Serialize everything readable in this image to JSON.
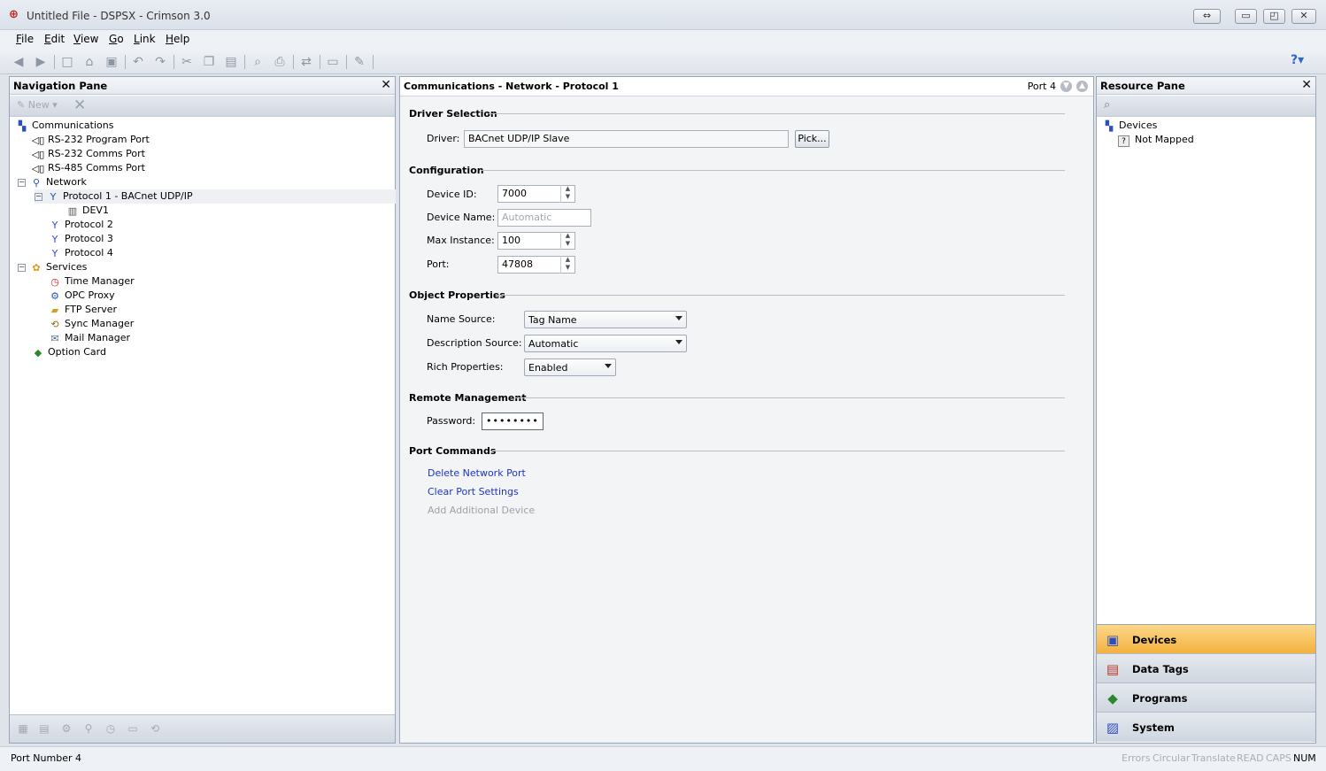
{
  "window": {
    "title": "Untitled File - DSPSX - Crimson 3.0",
    "app_icon": "crimson-app-icon",
    "controls": [
      "restore-toggle-icon",
      "minimize-icon",
      "maximize-icon",
      "close-icon"
    ]
  },
  "menu": [
    {
      "label": "File"
    },
    {
      "label": "Edit"
    },
    {
      "label": "View"
    },
    {
      "label": "Go"
    },
    {
      "label": "Link"
    },
    {
      "label": "Help"
    }
  ],
  "toolbar_icons": [
    "back-icon",
    "forward-icon",
    "new-file-icon",
    "open-icon",
    "save-icon",
    "undo-icon",
    "redo-icon",
    "cut-icon",
    "copy-icon",
    "paste-icon",
    "find-icon",
    "print-icon",
    "link-icon",
    "window-icon",
    "tool-icon",
    "help-icon"
  ],
  "nav_pane": {
    "title": "Navigation Pane",
    "new_label": "New",
    "tree": [
      {
        "label": "Communications",
        "icon": "communications-icon"
      },
      {
        "label": "RS-232 Program Port",
        "icon": "serial-port-icon"
      },
      {
        "label": "RS-232 Comms Port",
        "icon": "serial-port-icon"
      },
      {
        "label": "RS-485 Comms Port",
        "icon": "serial-port-icon"
      },
      {
        "label": "Network",
        "icon": "network-icon",
        "toggle": "−"
      },
      {
        "label": "Protocol 1 - BACnet UDP/IP",
        "icon": "protocol-icon",
        "toggle": "−"
      },
      {
        "label": "DEV1",
        "icon": "device-icon"
      },
      {
        "label": "Protocol 2",
        "icon": "protocol-icon"
      },
      {
        "label": "Protocol 3",
        "icon": "protocol-icon"
      },
      {
        "label": "Protocol 4",
        "icon": "protocol-icon"
      },
      {
        "label": "Services",
        "icon": "services-icon",
        "toggle": "−"
      },
      {
        "label": "Time Manager",
        "icon": "clock-icon"
      },
      {
        "label": "OPC Proxy",
        "icon": "opc-icon"
      },
      {
        "label": "FTP Server",
        "icon": "folder-icon"
      },
      {
        "label": "Sync Manager",
        "icon": "sync-icon"
      },
      {
        "label": "Mail Manager",
        "icon": "mail-icon"
      },
      {
        "label": "Option Card",
        "icon": "option-card-icon"
      }
    ]
  },
  "main": {
    "title": "Communications - Network - Protocol 1",
    "port_label": "Port 4",
    "driver_selection": {
      "title": "Driver Selection",
      "driver_label": "Driver:",
      "driver_value": "BACnet UDP/IP Slave",
      "pick_label": "Pick..."
    },
    "configuration": {
      "title": "Configuration",
      "device_id_label": "Device ID:",
      "device_id_value": "7000",
      "device_name_label": "Device Name:",
      "device_name_placeholder": "Automatic",
      "max_instance_label": "Max Instance:",
      "max_instance_value": "100",
      "port_label": "Port:",
      "port_value": "47808"
    },
    "object_properties": {
      "title": "Object Properties",
      "name_source_label": "Name Source:",
      "name_source_value": "Tag Name",
      "description_source_label": "Description Source:",
      "description_source_value": "Automatic",
      "rich_properties_label": "Rich Properties:",
      "rich_properties_value": "Enabled"
    },
    "remote_management": {
      "title": "Remote Management",
      "password_label": "Password:",
      "password_value": "••••••••"
    },
    "port_commands": {
      "title": "Port Commands",
      "delete": "Delete Network Port",
      "clear": "Clear Port Settings",
      "add_device": "Add Additional Device"
    }
  },
  "resource_pane": {
    "title": "Resource Pane",
    "tree": [
      {
        "label": "Devices",
        "icon": "devices-icon"
      },
      {
        "label": "Not Mapped",
        "icon": "unknown-icon"
      }
    ],
    "tabs": [
      {
        "label": "Devices",
        "icon": "devices-tab-icon",
        "active": true
      },
      {
        "label": "Data Tags",
        "icon": "data-tags-icon"
      },
      {
        "label": "Programs",
        "icon": "programs-icon"
      },
      {
        "label": "System",
        "icon": "system-icon"
      }
    ]
  },
  "status": {
    "text": "Port Number 4",
    "indicators": [
      {
        "label": "Errors",
        "on": false
      },
      {
        "label": "Circular",
        "on": false
      },
      {
        "label": "Translate",
        "on": false
      },
      {
        "label": "READ",
        "on": false
      },
      {
        "label": "CAPS",
        "on": false
      },
      {
        "label": "NUM",
        "on": true
      }
    ]
  }
}
